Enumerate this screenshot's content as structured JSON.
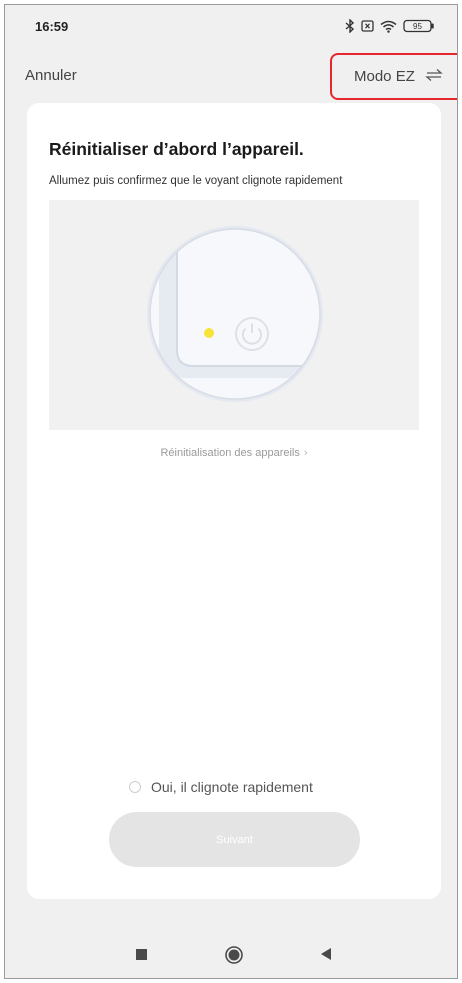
{
  "status_bar": {
    "time": "16:59",
    "battery": "95",
    "icons": [
      "bluetooth-icon",
      "sim-x-icon",
      "wifi-icon",
      "battery-icon"
    ]
  },
  "nav": {
    "cancel_label": "Annuler",
    "mode_label": "Modo EZ",
    "mode_icon": "swap-arrows-icon",
    "highlight_color": "#e8262d"
  },
  "card": {
    "title": "Réinitialiser d’abord l’appareil.",
    "subtitle": "Allumez puis confirmez que le voyant clignote rapidement",
    "illustration": {
      "icons": [
        "indicator-light-icon",
        "power-icon"
      ],
      "indicator_color": "#f6e43a"
    },
    "reset_link_label": "Réinitialisation des appareils",
    "reset_link_icon": "chevron-right-icon",
    "confirm_label": "Oui, il clignote rapidement",
    "confirm_checked": false,
    "next_button_label": "Suivant",
    "next_button_enabled": false
  },
  "system_nav": {
    "icons": [
      "recent-apps-icon",
      "home-icon",
      "back-icon"
    ]
  }
}
